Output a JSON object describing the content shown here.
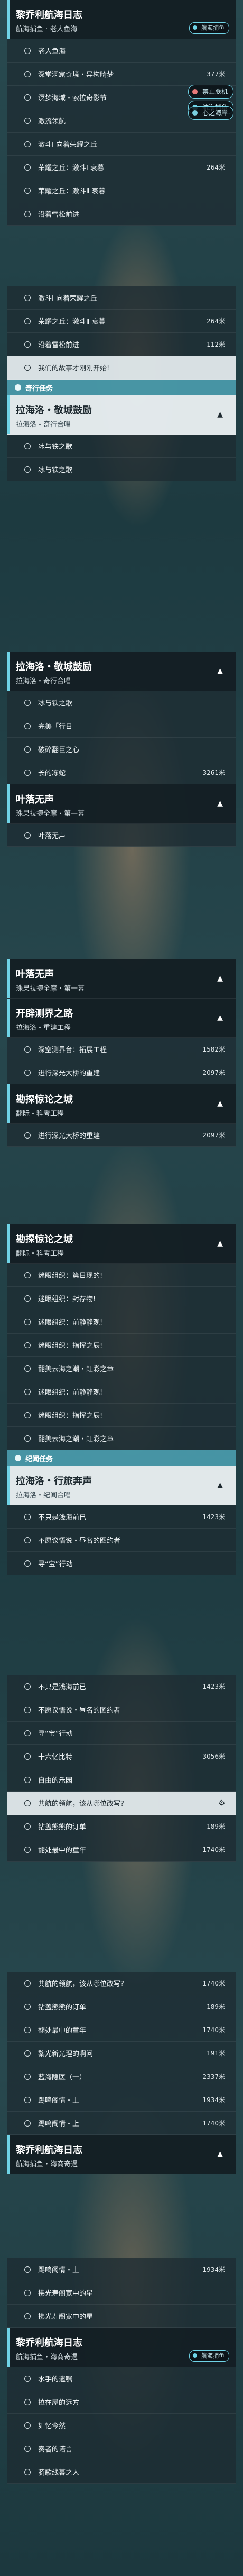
{
  "side_buttons": [
    {
      "label": "航海捕鱼",
      "color": "#6fd3e6"
    },
    {
      "label": "禁止联机",
      "color": "#e87a7a"
    },
    {
      "label": "心之海岸",
      "color": "#7acfe0"
    }
  ],
  "panels": [
    {
      "rows": [
        {
          "t": "hdr",
          "title": "黎乔利航海日志",
          "sub": "航海捕鱼 · 老人鱼海",
          "badge": "航海捕鱼"
        },
        {
          "t": "q",
          "text": "老人鱼海"
        },
        {
          "t": "q",
          "text": "深堂洞窟奇境・异构畸梦",
          "dist": "377米"
        },
        {
          "t": "q",
          "text": "溟梦海域・索拉奇影节"
        },
        {
          "t": "q",
          "text": "激流领航"
        },
        {
          "t": "q",
          "text": "激斗Ⅰ 向着荣耀之丘"
        },
        {
          "t": "q",
          "text": "荣耀之丘：激斗Ⅰ 衰暮",
          "dist": "264米"
        },
        {
          "t": "q",
          "text": "荣耀之丘：激斗Ⅱ 衰暮"
        },
        {
          "t": "q",
          "text": "沿着雪松前进"
        }
      ]
    },
    {
      "rows": [
        {
          "t": "q",
          "text": "激斗Ⅰ 向着荣耀之丘"
        },
        {
          "t": "q",
          "text": "荣耀之丘：激斗Ⅱ 衰暮",
          "dist": "264米"
        },
        {
          "t": "q",
          "text": "沿着雪松前进",
          "dist": "112米"
        },
        {
          "t": "q",
          "text": "我们的故事才刚刚开始!",
          "sel": true
        },
        {
          "t": "cat",
          "text": "奇行任务"
        },
        {
          "t": "hdr",
          "title": "拉海洛・敬城鼓励",
          "sub": "拉海洛・奇行合唱",
          "sel": true
        },
        {
          "t": "q",
          "text": "冰与铁之歌"
        },
        {
          "t": "q",
          "text": "冰与铁之歌"
        }
      ]
    },
    {
      "rows": [
        {
          "t": "hdr",
          "title": "拉海洛・敬城鼓励",
          "sub": "拉海洛・奇行合唱"
        },
        {
          "t": "q",
          "text": "冰与铁之歌"
        },
        {
          "t": "q",
          "text": "完美「行日"
        },
        {
          "t": "q",
          "text": "破碎翻巨之心"
        },
        {
          "t": "q",
          "text": "长的冻蛇",
          "dist": "3261米"
        },
        {
          "t": "hdr",
          "title": "叶落无声",
          "sub": "珠果拉捷全摩・第一幕"
        },
        {
          "t": "q",
          "text": "叶落无声"
        }
      ]
    },
    {
      "rows": [
        {
          "t": "hdr",
          "title": "叶落无声",
          "sub": "珠果拉捷全摩・第一幕"
        },
        {
          "t": "hdr",
          "title": "开辟测界之路",
          "sub": "拉海洛・重建工程"
        },
        {
          "t": "q",
          "text": "深空测界台：拓展工程",
          "dist": "1582米"
        },
        {
          "t": "q",
          "text": "进行深光大桥的重建",
          "dist": "2097米"
        },
        {
          "t": "hdr",
          "title": "勘探惊论之城",
          "sub": "翻际・科考工程"
        },
        {
          "t": "q",
          "text": "进行深光大桥的重建",
          "dist": "2097米"
        }
      ]
    },
    {
      "rows": [
        {
          "t": "hdr",
          "title": "勘探惊论之城",
          "sub": "翻际・科考工程"
        },
        {
          "t": "q",
          "text": "迷眼组织：第日现的!"
        },
        {
          "t": "q",
          "text": "迷眼组织：封存物!"
        },
        {
          "t": "q",
          "text": "迷眼组织：前静静观!"
        },
        {
          "t": "q",
          "text": "迷眼组织：指挥之辰!"
        },
        {
          "t": "q",
          "text": "翻美云海之潮・虹彩之章"
        },
        {
          "t": "q",
          "text": "迷眼组织：前静静观!"
        },
        {
          "t": "q",
          "text": "迷眼组织：指挥之辰!"
        },
        {
          "t": "q",
          "text": "翻美云海之潮・虹彩之章"
        },
        {
          "t": "cat",
          "text": "纪闻任务"
        },
        {
          "t": "hdr",
          "title": "拉海洛・行旅奔声",
          "sub": "拉海洛・纪闻合唱",
          "sel": true
        },
        {
          "t": "q",
          "text": "不只是浅海前已",
          "dist": "1423米"
        },
        {
          "t": "q",
          "text": "不愿议悟说・昼名的图约者"
        },
        {
          "t": "q",
          "text": "寻“宝”行动"
        }
      ]
    },
    {
      "rows": [
        {
          "t": "q",
          "text": "不只是浅海前已",
          "dist": "1423米"
        },
        {
          "t": "q",
          "text": "不愿议悟说・昼名的图约者"
        },
        {
          "t": "q",
          "text": "寻“宝”行动"
        },
        {
          "t": "q",
          "text": "十六亿比特",
          "dist": "3056米"
        },
        {
          "t": "q",
          "text": "自由的乐园"
        },
        {
          "t": "q",
          "text": "共航的领航，该从哪位改写?",
          "sel": true,
          "gear": true
        },
        {
          "t": "q",
          "text": "钻盖熊熊的订单",
          "dist": "189米"
        },
        {
          "t": "q",
          "text": "翻处最中的童年",
          "dist": "1740米"
        }
      ]
    },
    {
      "rows": [
        {
          "t": "q",
          "text": "共航的领航，该从哪位改写?",
          "dist": "1740米"
        },
        {
          "t": "q",
          "text": "钻盖熊熊的订单",
          "dist": "189米"
        },
        {
          "t": "q",
          "text": "翻处最中的童年",
          "dist": "1740米"
        },
        {
          "t": "q",
          "text": "黎光新光理的啊问",
          "dist": "191米"
        },
        {
          "t": "q",
          "text": "蓝海隐医（一）",
          "dist": "2337米"
        },
        {
          "t": "q",
          "text": "踢鸣阁情・上",
          "dist": "1934米"
        },
        {
          "t": "q",
          "text": "踢鸣阁情・上",
          "dist": "1740米"
        },
        {
          "t": "hdr",
          "title": "黎乔利航海日志",
          "sub": "航海捕鱼・海商奇遇"
        }
      ]
    },
    {
      "rows": [
        {
          "t": "q",
          "text": "踢鸣阁情・上",
          "dist": "1934米"
        },
        {
          "t": "q",
          "text": "拂光寿阁宽中的星"
        },
        {
          "t": "q",
          "text": "拂光寿阁宽中的星"
        },
        {
          "t": "hdr",
          "title": "黎乔利航海日志",
          "sub": "航海捕鱼・海商奇遇",
          "badge": "航海捕鱼"
        },
        {
          "t": "q",
          "text": "水手的遗嘱"
        },
        {
          "t": "q",
          "text": "拉在屋的远方"
        },
        {
          "t": "q",
          "text": "如忆今然"
        },
        {
          "t": "q",
          "text": "奏者的诺言"
        },
        {
          "t": "q",
          "text": "骑歌线暮之人"
        }
      ]
    }
  ]
}
